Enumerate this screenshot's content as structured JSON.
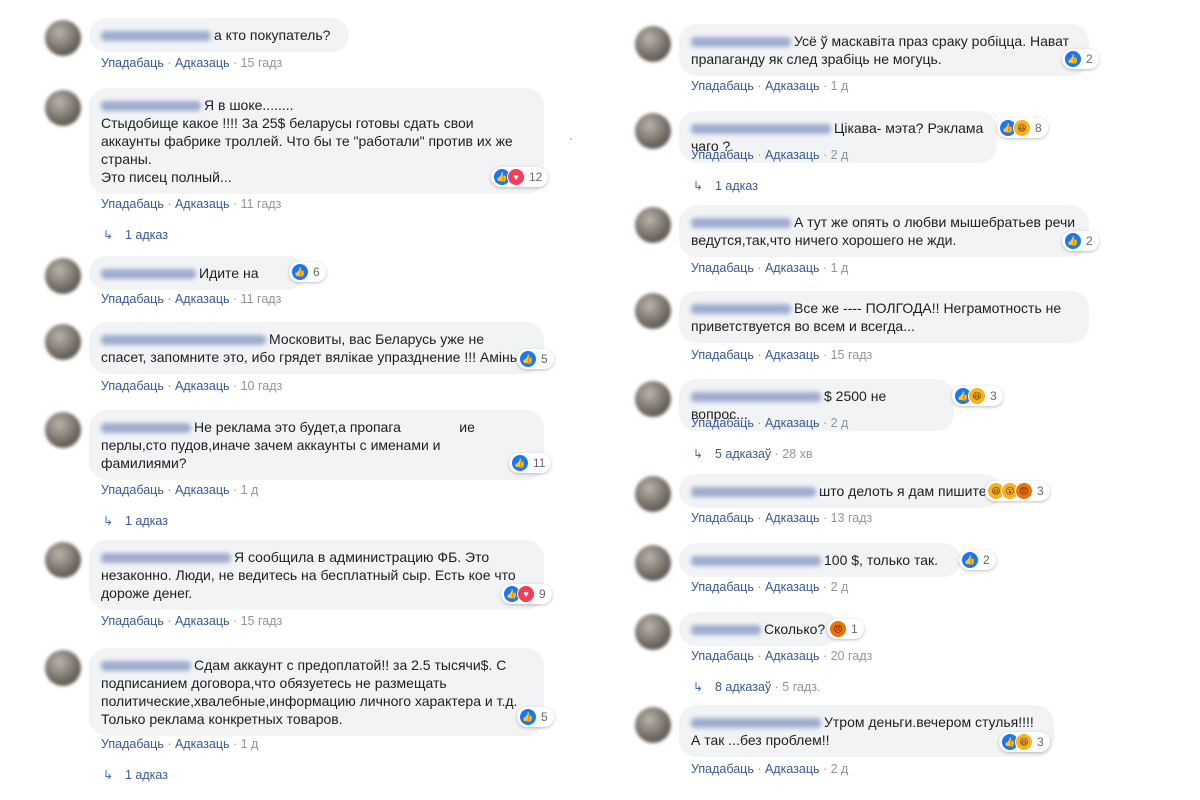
{
  "labels": {
    "like": "Упадабаць",
    "reply": "Адказаць",
    "sep": "·"
  },
  "left": [
    {
      "text": "а кто покупатель?",
      "time": "15 гадз"
    },
    {
      "text": "Я в шоке........\nСтыдобище какое !!!! За 25$ беларусы готовы сдать свои\nаккаунты фабрике троллей. Что бы те \"работали\" против их же\nстраны.\nЭто писец полный...",
      "time": "11 гадз",
      "reactions": {
        "icons": [
          "like",
          "love"
        ],
        "count": "12"
      },
      "replies": {
        "label": "1 адказ"
      }
    },
    {
      "text": "Идите на",
      "time": "11 гадз",
      "reactions": {
        "icons": [
          "like"
        ],
        "count": "6"
      }
    },
    {
      "text": "Московиты, вас Беларусь уже не\nспасет, запомните это, ибо грядет вялікае упразднение !!! Амінь",
      "time": "10 гадз",
      "reactions": {
        "icons": [
          "like"
        ],
        "count": "5"
      }
    },
    {
      "text": "Не реклама это будет,а пропага               ие\nперлы,сто пудов,иначе зачем аккаунты с именами и\nфамилиями?",
      "time": "1 д",
      "reactions": {
        "icons": [
          "like"
        ],
        "count": "11"
      },
      "replies": {
        "label": "1 адказ"
      }
    },
    {
      "text": "Я сообщила в администрацию ФБ. Это\nнезаконно. Люди, не ведитесь на бесплатный сыр. Есть кое что\nдороже денег.",
      "time": "15 гадз",
      "reactions": {
        "icons": [
          "like",
          "love"
        ],
        "count": "9"
      }
    },
    {
      "text": "Сдам аккаунт с предоплатой!! за 2.5 тысячи$. С\nподписанием договора,что обязуетесь не размещать\nполитические,хвалебные,информацию личного характера и т.д.\nТолько реклама конкретных товаров.",
      "time": "1 д",
      "reactions": {
        "icons": [
          "like"
        ],
        "count": "5"
      },
      "replies": {
        "label": "1 адказ"
      }
    }
  ],
  "right": [
    {
      "text": "Усё ў маскавіта праз сраку робіцца. Нават\nпрапаганду як след зрабіць не могуць.",
      "time": "1 д",
      "reactions": {
        "icons": [
          "like"
        ],
        "count": "2"
      }
    },
    {
      "text": "Цікава- мэта? Рэклама чаго ?",
      "time": "2 д",
      "reactions": {
        "icons": [
          "like",
          "haha"
        ],
        "count": "8"
      },
      "replies": {
        "label": "1 адказ"
      }
    },
    {
      "text": "А тут же опять о любви мышебратьев речи\nведутся,так,что ничего хорошего не жди.",
      "time": "1 д",
      "reactions": {
        "icons": [
          "like"
        ],
        "count": "2"
      }
    },
    {
      "text": "Все же ---- ПОЛГОДА!! Неграмотность не\nприветствуется во всем и всегда...",
      "time": "15 гадз"
    },
    {
      "text": "$ 2500 не вопрос...",
      "time": "2 д",
      "reactions": {
        "icons": [
          "like",
          "haha"
        ],
        "count": "3"
      },
      "replies": {
        "label": "5 адказаў",
        "time": "28 хв"
      }
    },
    {
      "text": "што делоть я дам пишите",
      "time": "13 гадз",
      "reactions": {
        "icons": [
          "haha",
          "wow",
          "angry"
        ],
        "count": "3"
      }
    },
    {
      "text": "100 $, только так.",
      "time": "2 д",
      "reactions": {
        "icons": [
          "like"
        ],
        "count": "2"
      }
    },
    {
      "text": "Сколько?",
      "time": "20 гадз",
      "reactions": {
        "icons": [
          "angry"
        ],
        "count": "1"
      },
      "replies": {
        "label": "8 адказаў",
        "time": "5 гадз."
      }
    },
    {
      "text": "Утром деньги.вечером стулья!!!!\nА так ...без проблем!!",
      "time": "2 д",
      "reactions": {
        "icons": [
          "like",
          "haha"
        ],
        "count": "3"
      }
    }
  ],
  "icon_glyphs": {
    "like": "👍",
    "love": "♥",
    "haha": "😆",
    "wow": "😮",
    "angry": "😠"
  },
  "reply_arrow": "↳"
}
